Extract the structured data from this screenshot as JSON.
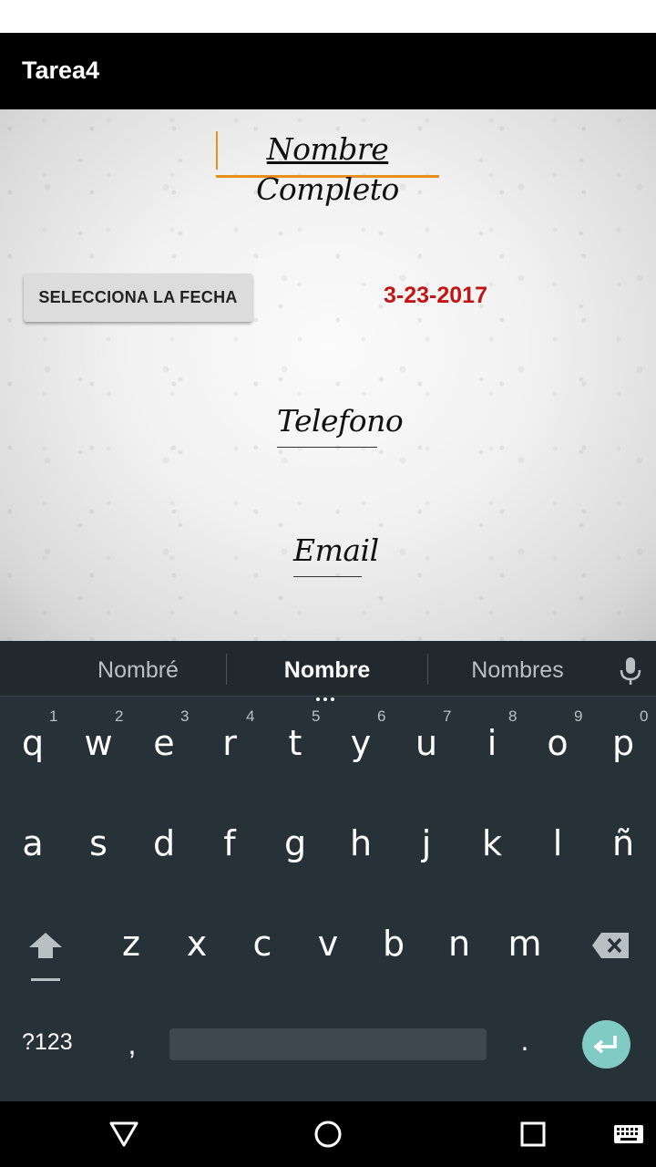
{
  "app": {
    "title": "Tarea4"
  },
  "form": {
    "name_word1": "Nombre",
    "name_word2": " Completo",
    "date_button": "SELECCIONA LA FECHA",
    "date_value": "3-23-2017",
    "phone_hint": "Telefono",
    "email_hint": "Email"
  },
  "keyboard": {
    "suggestions": [
      "Nombré",
      "Nombre",
      "Nombres"
    ],
    "row1": [
      "q",
      "w",
      "e",
      "r",
      "t",
      "y",
      "u",
      "i",
      "o",
      "p"
    ],
    "row1_hints": [
      "1",
      "2",
      "3",
      "4",
      "5",
      "6",
      "7",
      "8",
      "9",
      "0"
    ],
    "row2": [
      "a",
      "s",
      "d",
      "f",
      "g",
      "h",
      "j",
      "k",
      "l",
      "ñ"
    ],
    "row3": [
      "z",
      "x",
      "c",
      "v",
      "b",
      "n",
      "m"
    ],
    "symbols_label": "?123",
    "comma": ",",
    "period": "."
  },
  "colors": {
    "accent": "#e8901c",
    "date_text": "#c41414",
    "keyboard_bg": "#263238",
    "enter_key": "#80cbc4"
  }
}
